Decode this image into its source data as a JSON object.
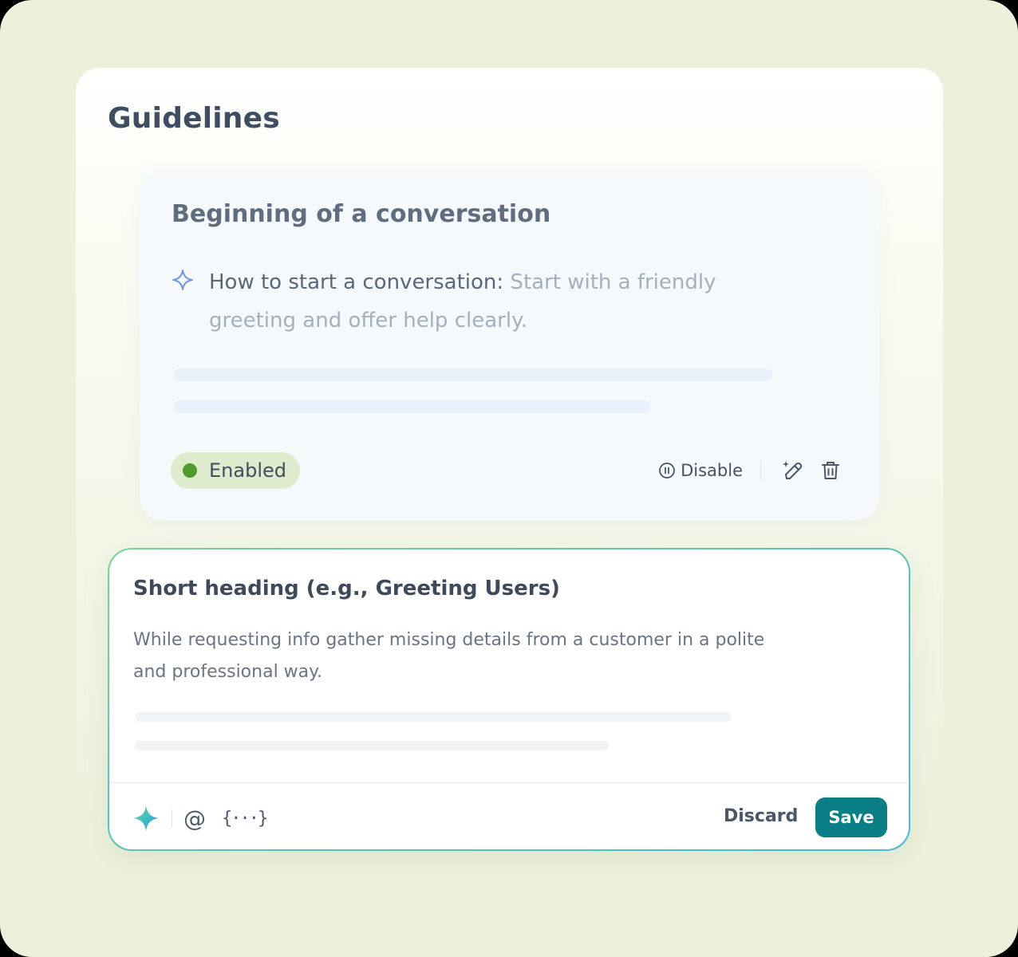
{
  "page": {
    "title": "Guidelines"
  },
  "guideline": {
    "title": "Beginning of a conversation",
    "rule_label": "How to start a conversation:",
    "rule_text": " Start with a friendly greeting and offer help clearly.",
    "status": "Enabled",
    "disable_label": "Disable",
    "icons": [
      "sparkle-icon",
      "pause-circle-icon",
      "magic-edit-icon",
      "trash-icon"
    ]
  },
  "editor": {
    "heading": "Short heading (e.g., Greeting Users)",
    "body": "While requesting info gather missing details from a customer in a polite and professional way.",
    "mention_symbol": "@",
    "variable_symbol": "{···}",
    "discard_label": "Discard",
    "save_label": "Save",
    "icons": [
      "ai-sparkle-icon",
      "mention-icon",
      "variable-icon"
    ]
  },
  "colors": {
    "background": "#ecf1dc",
    "enabled_dot": "#4f9b2f",
    "enabled_badge": "#deebcc",
    "save_button": "#0b7f86",
    "editor_border_start": "#7fd28f",
    "editor_border_end": "#4db7d6"
  }
}
